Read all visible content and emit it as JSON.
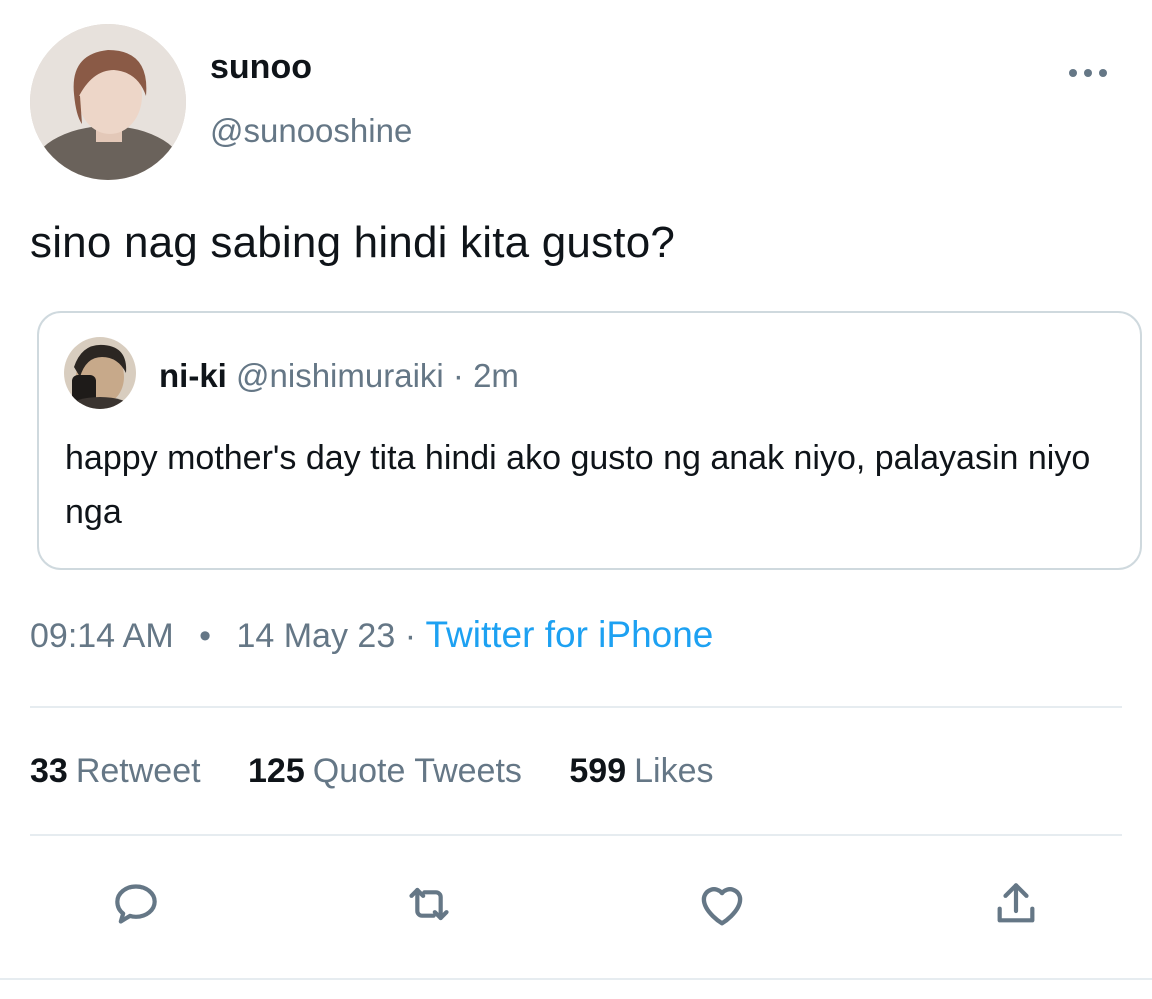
{
  "tweet": {
    "author": {
      "display_name": "sunoo",
      "handle": "@sunooshine"
    },
    "text": "sino nag sabing hindi kita gusto?",
    "quoted": {
      "display_name": "ni-ki",
      "handle": "@nishimuraiki",
      "separator": "·",
      "time": "2m",
      "text": "happy mother's day tita hindi ako gusto ng anak niyo, palayasin niyo nga"
    },
    "meta": {
      "time": "09:14 AM",
      "dot": "•",
      "date": "14 May 23",
      "separator": "·",
      "source": "Twitter for iPhone"
    },
    "stats": {
      "retweets": {
        "count": "33",
        "label": "Retweet"
      },
      "quotes": {
        "count": "125",
        "label": "Quote Tweets"
      },
      "likes": {
        "count": "599",
        "label": "Likes"
      }
    }
  },
  "icons": {
    "more": "more-horizontal-icon",
    "reply": "reply-icon",
    "retweet": "retweet-icon",
    "like": "heart-icon",
    "share": "share-icon"
  },
  "colors": {
    "text_primary": "#0f1419",
    "text_secondary": "#657786",
    "link": "#1da1f2",
    "border": "#cfd9de",
    "divider": "#e6ecf0"
  }
}
